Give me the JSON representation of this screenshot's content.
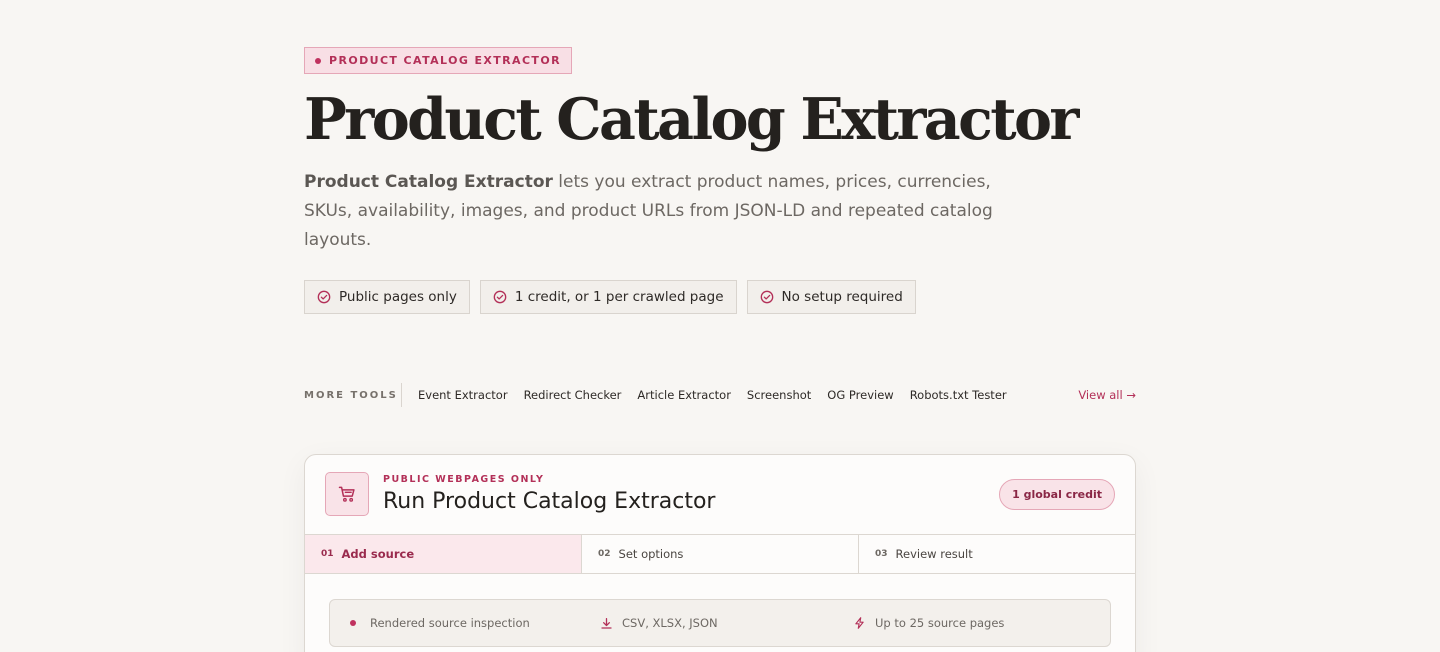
{
  "badge": "PRODUCT CATALOG EXTRACTOR",
  "title": "Product Catalog Extractor",
  "lede": {
    "bold": "Product Catalog Extractor",
    "text": " lets you extract product names, prices, currencies, SKUs, availability, images, and product URLs from JSON-LD and repeated catalog layouts."
  },
  "chips": [
    {
      "icon": "check-circle-icon",
      "label": "Public pages only"
    },
    {
      "icon": "check-circle-icon",
      "label": "1 credit, or 1 per crawled page"
    },
    {
      "icon": "check-circle-icon",
      "label": "No setup required"
    }
  ],
  "more_tools": {
    "label": "MORE TOOLS",
    "links": [
      "Event Extractor",
      "Redirect Checker",
      "Article Extractor",
      "Screenshot",
      "OG Preview",
      "Robots.txt Tester"
    ],
    "view_all": "View all →"
  },
  "card": {
    "icon": "cart-icon",
    "eyebrow": "PUBLIC WEBPAGES ONLY",
    "title": "Run Product Catalog Extractor",
    "credit": "1 global credit",
    "steps": [
      {
        "num": "01",
        "label": "Add source",
        "active": true
      },
      {
        "num": "02",
        "label": "Set options",
        "active": false
      },
      {
        "num": "03",
        "label": "Review result",
        "active": false
      }
    ],
    "info": [
      {
        "icon": "dot-icon",
        "label": "Rendered source inspection"
      },
      {
        "icon": "download-icon",
        "label": "CSV, XLSX, JSON"
      },
      {
        "icon": "bolt-icon",
        "label": "Up to 25 source pages"
      }
    ]
  },
  "colors": {
    "accent": "#b33058",
    "background": "#f8f6f3"
  }
}
